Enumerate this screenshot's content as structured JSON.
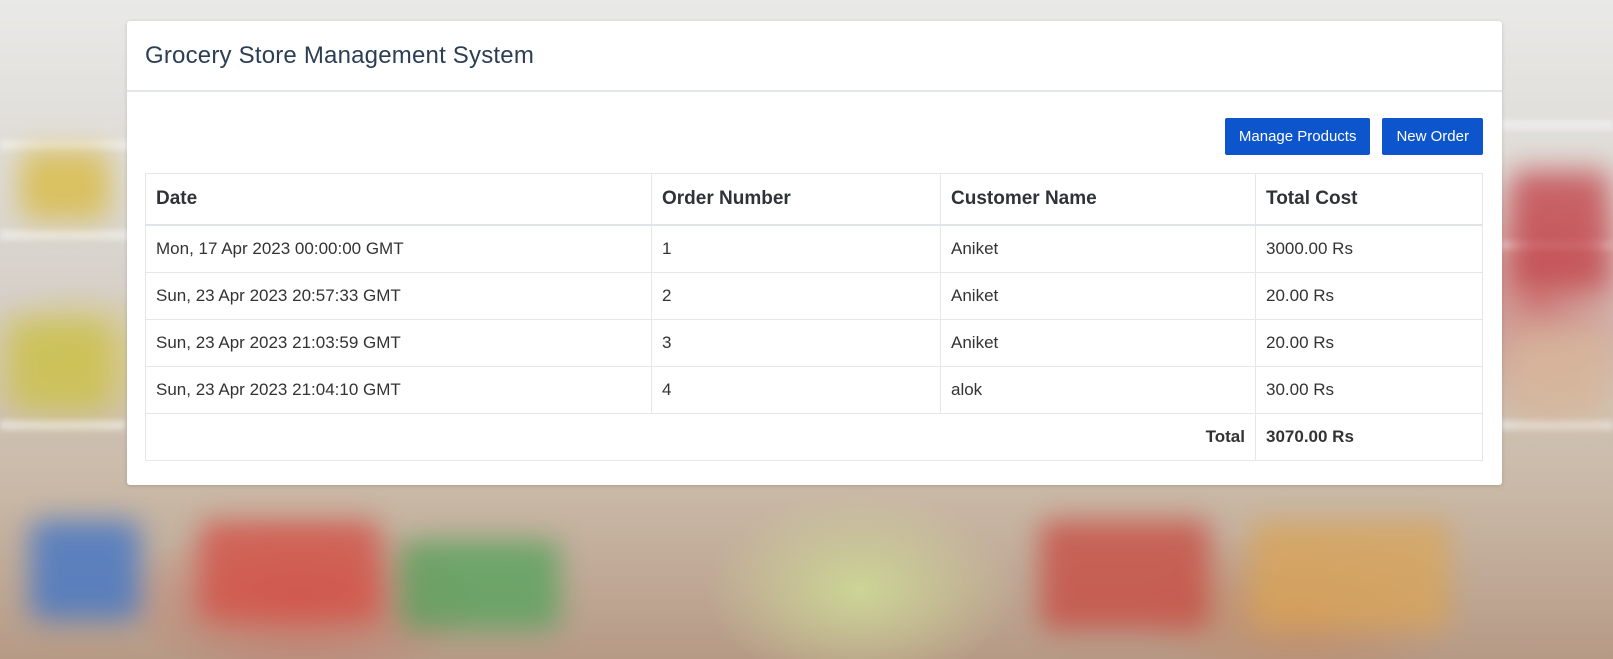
{
  "app": {
    "title": "Grocery Store Management System"
  },
  "toolbar": {
    "manage_products_label": "Manage Products",
    "new_order_label": "New Order"
  },
  "colors": {
    "primary_button": "#0d55cc",
    "title_text": "#2c3e55"
  },
  "orders": {
    "headers": {
      "date": "Date",
      "order_number": "Order Number",
      "customer_name": "Customer Name",
      "total_cost": "Total Cost"
    },
    "rows": [
      {
        "date": "Mon, 17 Apr 2023 00:00:00 GMT",
        "order_number": "1",
        "customer_name": "Aniket",
        "total_cost": "3000.00 Rs"
      },
      {
        "date": "Sun, 23 Apr 2023 20:57:33 GMT",
        "order_number": "2",
        "customer_name": "Aniket",
        "total_cost": "20.00 Rs"
      },
      {
        "date": "Sun, 23 Apr 2023 21:03:59 GMT",
        "order_number": "3",
        "customer_name": "Aniket",
        "total_cost": "20.00 Rs"
      },
      {
        "date": "Sun, 23 Apr 2023 21:04:10 GMT",
        "order_number": "4",
        "customer_name": "alok",
        "total_cost": "30.00 Rs"
      }
    ],
    "footer": {
      "total_label": "Total",
      "total_value": "3070.00 Rs"
    }
  }
}
